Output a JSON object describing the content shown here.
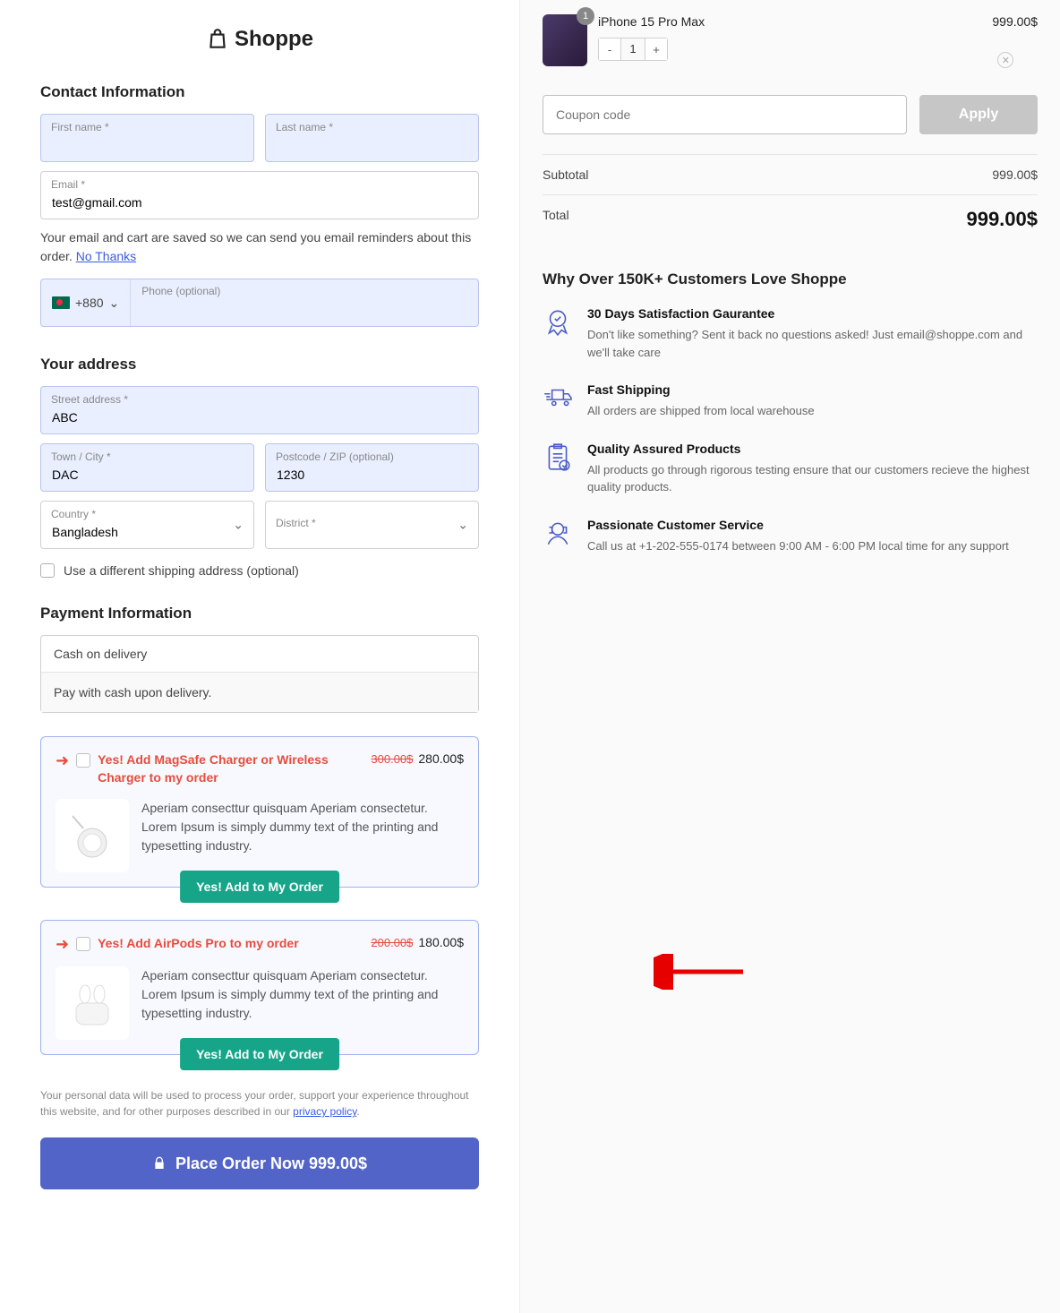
{
  "brand": "Shoppe",
  "contact": {
    "heading": "Contact Information",
    "first_name_label": "First name *",
    "last_name_label": "Last name *",
    "email_label": "Email *",
    "email_value": "test@gmail.com",
    "hint_text": "Your email and cart are saved so we can send you email reminders about this order. ",
    "hint_link": "No Thanks",
    "phone_cc": "+880",
    "phone_label": "Phone (optional)"
  },
  "address": {
    "heading": "Your address",
    "street_label": "Street address *",
    "street_value": "ABC",
    "town_label": "Town / City *",
    "town_value": "DAC",
    "postcode_label": "Postcode / ZIP (optional)",
    "postcode_value": "1230",
    "country_label": "Country *",
    "country_value": "Bangladesh",
    "district_label": "District *",
    "diff_ship": "Use a different shipping address (optional)"
  },
  "payment": {
    "heading": "Payment Information",
    "method": "Cash on delivery",
    "desc": "Pay with cash upon delivery."
  },
  "upsells": [
    {
      "title": "Yes! Add MagSafe Charger or Wireless Charger to my order",
      "old": "300.00$",
      "new": "280.00$",
      "desc": "Aperiam consecttur quisquam Aperiam consectetur. Lorem Ipsum is simply dummy text of the printing and typesetting industry.",
      "btn": "Yes! Add to My Order"
    },
    {
      "title": "Yes! Add AirPods Pro to my order",
      "old": "200.00$",
      "new": "180.00$",
      "desc": "Aperiam consecttur quisquam Aperiam consectetur. Lorem Ipsum is simply dummy text of the printing and typesetting industry.",
      "btn": "Yes! Add to My Order"
    }
  ],
  "privacy_text": "Your personal data will be used to process your order, support your experience throughout this website, and for other purposes described in our ",
  "privacy_link": "privacy policy",
  "place_order": "Place Order Now  999.00$",
  "cart": {
    "item_name": "iPhone 15 Pro Max",
    "item_price": "999.00$",
    "qty": "1",
    "badge": "1",
    "coupon_ph": "Coupon code",
    "apply": "Apply",
    "subtotal_label": "Subtotal",
    "subtotal_value": "999.00$",
    "total_label": "Total",
    "total_value": "999.00$"
  },
  "why": {
    "heading": "Why Over 150K+ Customers Love Shoppe",
    "items": [
      {
        "title": "30 Days Satisfaction Gaurantee",
        "desc": "Don't like something? Sent it back no questions asked! Just email@shoppe.com and we'll take care"
      },
      {
        "title": "Fast Shipping",
        "desc": "All orders are shipped from local warehouse"
      },
      {
        "title": "Quality Assured Products",
        "desc": "All products go through rigorous testing ensure that our customers recieve the highest quality products."
      },
      {
        "title": "Passionate Customer Service",
        "desc": "Call us at +1-202-555-0174 between 9:00 AM - 6:00 PM local time for any support"
      }
    ]
  }
}
